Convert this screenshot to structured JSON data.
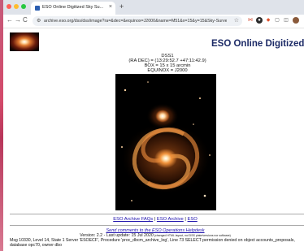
{
  "tab": {
    "title": "ESO Online Digitized Sky Su...",
    "close": "×",
    "new_tab": "+"
  },
  "toolbar": {
    "back": "←",
    "forward": "→",
    "reload": "C",
    "url": "archive.eso.org/dss/dss/image?ra=&dec=&equinox=J2000&name=M51&x=15&y=15&Sky-Survey..."
  },
  "page": {
    "heading": "ESO Online Digitized Sky Survey",
    "survey": "DSS1",
    "coords": "(RA DEC) = (13:29:52.7 +47:11:42.9)",
    "box": "BOX = 15 x 15 arcmin",
    "equinox": "EQUINOX = J2000"
  },
  "footer": {
    "faqs": "ESO Archive FAQs",
    "sep1": " | ",
    "archive": "ESO Archive",
    "sep2": " | ",
    "eso": "ESO",
    "comments": "Send comments to the ESO Operations Helpdesk",
    "version": "Version: 2.2 - Last update: 15 Jul 2020",
    "version_note": " (changed HTML layout, nul DSS plate/versions nor software)",
    "message": "Msg 10330, Level 14, State 1 Server 'ESOECF', Procedure 'proc_dbcm_archive_log', Line 73 SELECT permission denied on object accounts_proposals, database opc70, owner dbo"
  },
  "colors": {
    "heading": "#1c2a66",
    "link": "#1a0dab",
    "sky": "#000000"
  }
}
